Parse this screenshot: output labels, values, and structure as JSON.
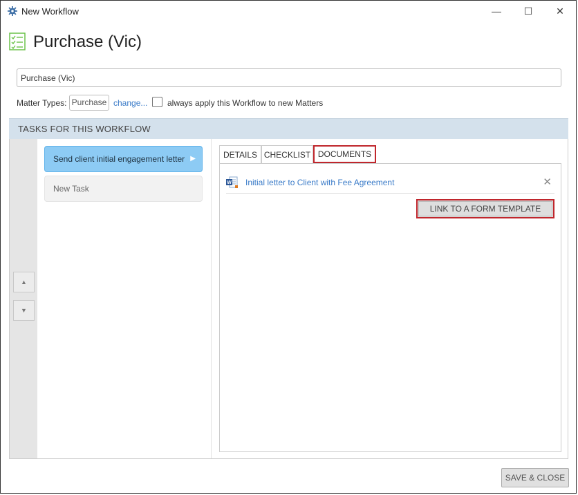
{
  "window": {
    "title": "New Workflow",
    "minimize_glyph": "—",
    "maximize_glyph": "☐",
    "close_glyph": "✕"
  },
  "header": {
    "icon": "checklist-icon",
    "title": "Purchase (Vic)"
  },
  "workflow_name": {
    "value": "Purchase (Vic)"
  },
  "matter_types": {
    "label": "Matter Types:",
    "value": "Purchase",
    "change_label": "change...",
    "always_apply_checked": false,
    "always_apply_label": "always apply this Workflow to new Matters"
  },
  "tasks_section": {
    "title": "TASKS FOR THIS WORKFLOW",
    "move_up_glyph": "▲",
    "move_down_glyph": "▼",
    "tasks": [
      {
        "label": "Send client initial engagement letter",
        "selected": true
      },
      {
        "label": "New Task",
        "selected": false
      }
    ]
  },
  "tabs": [
    {
      "label": "DETAILS",
      "active": false
    },
    {
      "label": "CHECKLIST",
      "active": false
    },
    {
      "label": "DOCUMENTS",
      "active": true
    }
  ],
  "documents": {
    "items": [
      {
        "icon": "word-document-icon",
        "label": "Initial letter to Client with Fee Agreement",
        "remove_glyph": "✕"
      }
    ],
    "link_button_label": "LINK TO A FORM TEMPLATE"
  },
  "footer": {
    "save_close_label": "SAVE & CLOSE"
  },
  "colors": {
    "accent_link": "#3a7bc8",
    "selected_task": "#8dcbf4",
    "section_bar": "#d4e1ec",
    "highlight_border": "#c0262c"
  }
}
